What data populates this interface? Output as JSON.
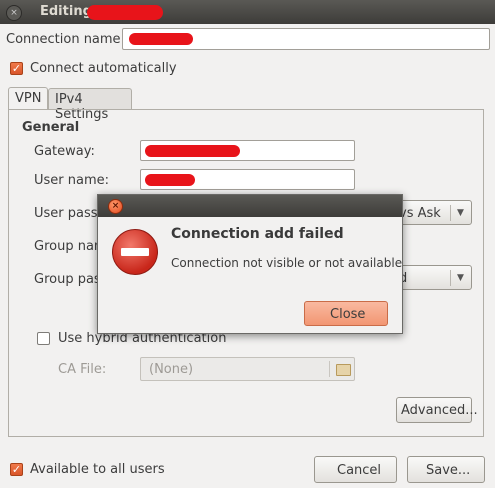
{
  "window": {
    "title": "Editing"
  },
  "connection": {
    "name_label": "Connection name:"
  },
  "connect_auto": {
    "label": "Connect automatically",
    "checked": true
  },
  "tabs": [
    {
      "label": "VPN"
    },
    {
      "label": "IPv4 Settings"
    }
  ],
  "general": {
    "heading": "General",
    "gateway_label": "Gateway:",
    "username_label": "User name:",
    "user_password_label": "User passw",
    "user_password_combo_value": "vs Ask",
    "group_name_label": "Group nam",
    "group_password_label": "Group pass",
    "group_password_combo_value": "d"
  },
  "hybrid": {
    "label": "Use hybrid authentication",
    "checked": false
  },
  "ca_file": {
    "label": "CA File:",
    "value": "(None)"
  },
  "buttons": {
    "advanced": "Advanced...",
    "cancel": "Cancel",
    "save": "Save..."
  },
  "available_all": {
    "label": "Available to all users",
    "checked": true
  },
  "dialog": {
    "title": "Connection add failed",
    "message": "Connection not visible or not available",
    "close_button": "Close",
    "close_glyph": "×"
  },
  "icons": {
    "window_close": "close-icon",
    "dialog_close": "close-icon",
    "error": "error-icon",
    "folder": "folder-icon",
    "combo_arrow": "chevron-down-icon"
  },
  "colors": {
    "accent": "#e8601f",
    "redaction": "#e8141a",
    "error_red": "#c8261a"
  }
}
